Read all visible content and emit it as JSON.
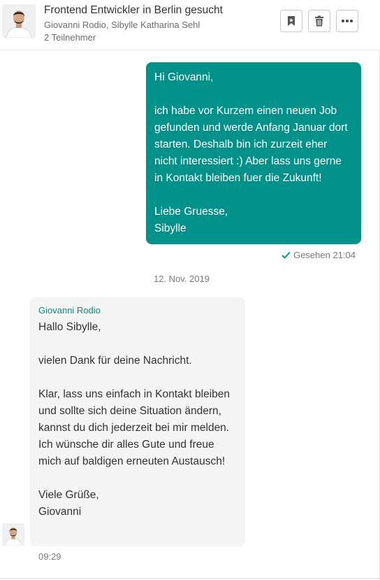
{
  "conversation": {
    "title": "Frontend Entwickler in Berlin gesucht",
    "participants": "Giovanni Rodio, Sibylle Katharina Sehl",
    "participant_count": "2 Teilnehmer"
  },
  "header_icons": {
    "bookmark": "bookmark-icon",
    "trash": "trash-icon",
    "more": "more-icon"
  },
  "messages": [
    {
      "direction": "outgoing",
      "text": "Hi Giovanni,\n\nich habe vor Kurzem einen neuen Job gefunden und werde Anfang Januar dort starten. Deshalb bin ich zurzeit eher nicht interessiert :) Aber lass uns gerne in Kontakt bleiben fuer die Zukunft!\n\nLiebe Gruesse,\nSibylle",
      "status": "Gesehen 21:04"
    },
    {
      "direction": "incoming",
      "sender": "Giovanni Rodio",
      "text": "Hallo Sibylle,\n\nvielen Dank für deine Nachricht.\n\nKlar, lass uns einfach in Kontakt bleiben und sollte sich deine Situation ändern, kannst du dich jederzeit bei mir melden.  Ich wünsche dir alles Gute und freue mich auf baldigen erneuten Austausch!\n\nViele Grüße,\nGiovanni",
      "time": "09:29"
    }
  ],
  "date_separator": "12. Nov. 2019",
  "colors": {
    "accent": "#00918a",
    "incoming_bubble": "#f4f4f4",
    "muted_text": "#7a7a7a"
  }
}
